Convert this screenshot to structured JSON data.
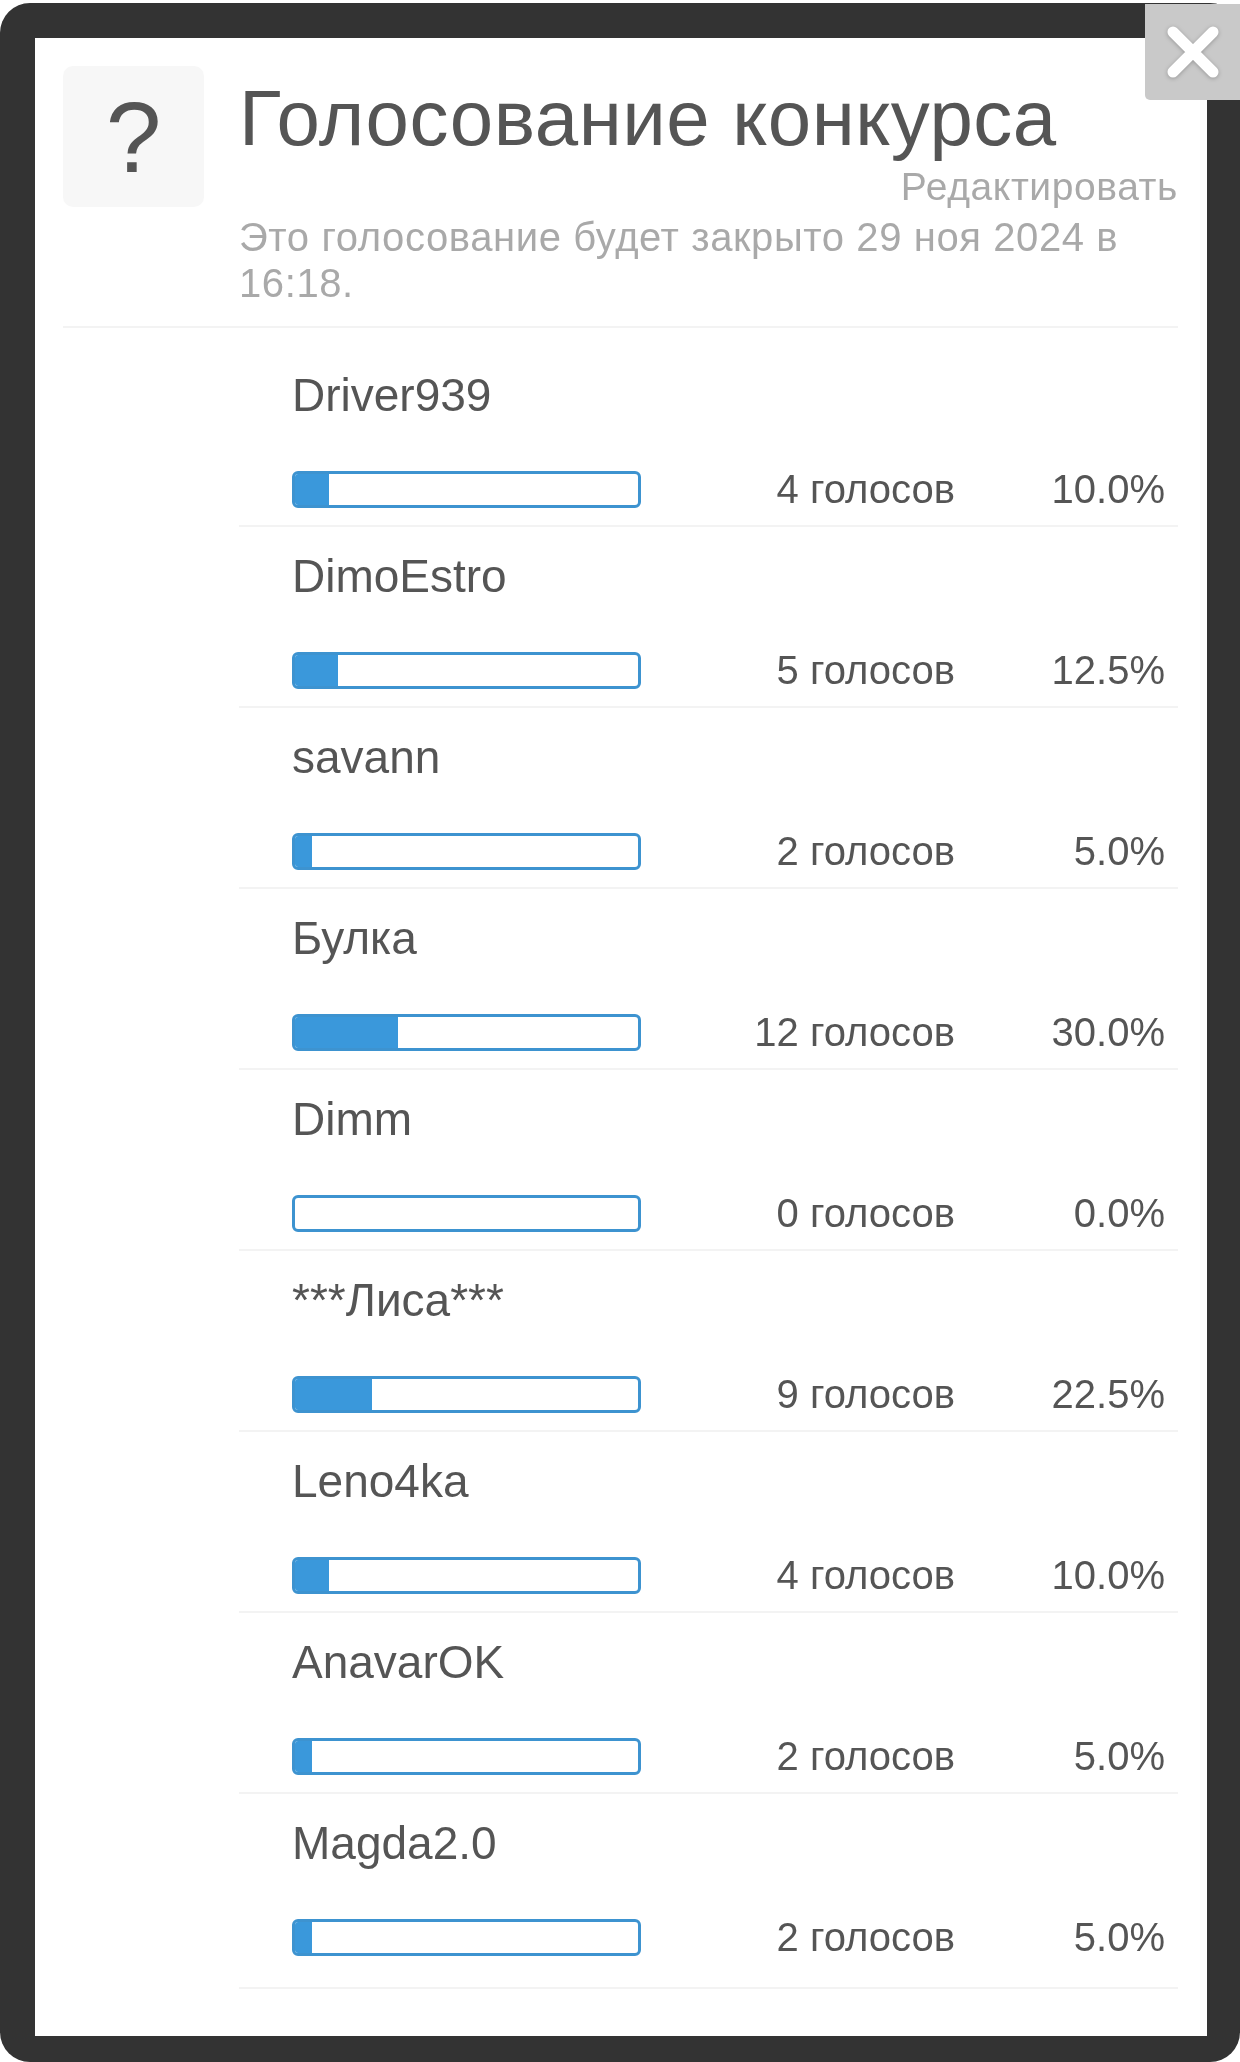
{
  "dialog": {
    "icon_glyph": "?",
    "title": "Голосование конкурса",
    "edit_link": "Редактировать",
    "closing_note": "Это голосование будет закрыто 29 ноя 2024 в 16:18."
  },
  "options": [
    {
      "name": "Driver939",
      "level": 0.1,
      "votes": "4 голосов",
      "percent": "10.0%"
    },
    {
      "name": "DimoEstro",
      "level": 0.125,
      "votes": "5 голосов",
      "percent": "12.5%"
    },
    {
      "name": "savann",
      "level": 0.05,
      "votes": "2 голосов",
      "percent": "5.0%"
    },
    {
      "name": "Булка",
      "level": 0.3,
      "votes": "12 голосов",
      "percent": "30.0%"
    },
    {
      "name": "Dimm",
      "votes": "0 голосов",
      "percent": "0.0%"
    },
    {
      "name": "***Лиса***",
      "level": 0.225,
      "votes": "9 голосов",
      "percent": "22.5%"
    },
    {
      "name": "Leno4ka",
      "level": 0.1,
      "votes": "4 голосов",
      "percent": "10.0%"
    },
    {
      "name": "AnavarOK",
      "level": 0.05,
      "votes": "2 голосов",
      "percent": "5.0%"
    },
    {
      "name": "Magda2.0",
      "level": 0.05,
      "votes": "2 голосов",
      "percent": "5.0%"
    }
  ]
}
